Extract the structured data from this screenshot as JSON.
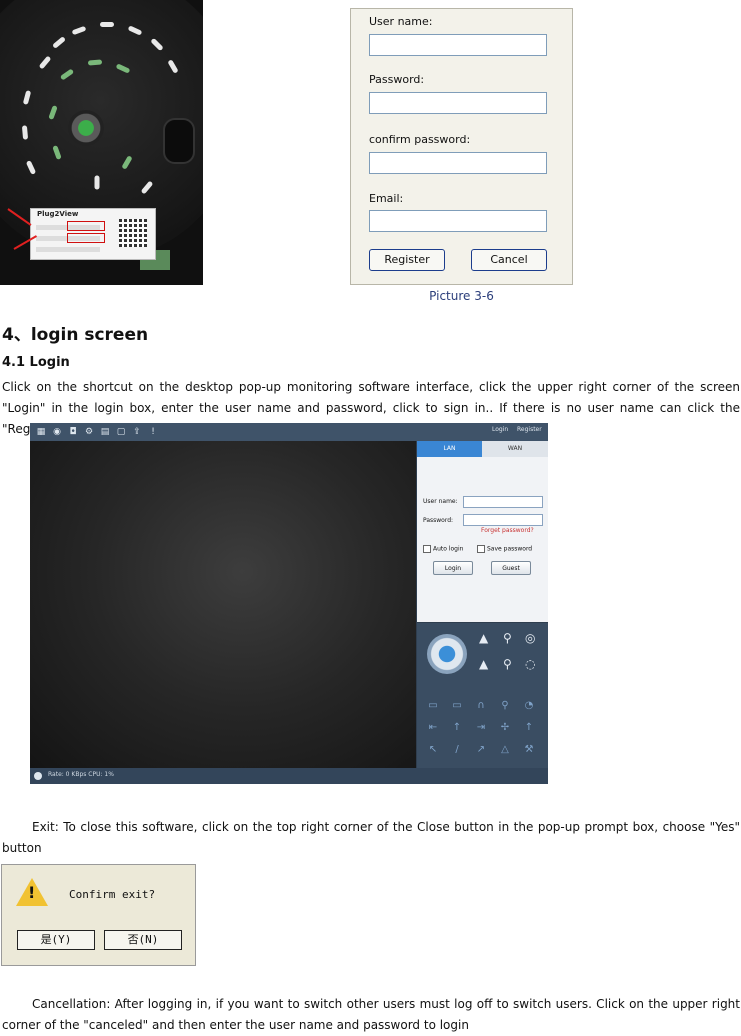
{
  "photo": {
    "brand_label": "Plug2View"
  },
  "register_dialog": {
    "username_label": "User name:",
    "password_label": "Password:",
    "confirm_label": "confirm password:",
    "email_label": "Email:",
    "register_button": "Register",
    "cancel_button": "Cancel"
  },
  "caption_1": "Picture 3-6",
  "section_heading": "4、login screen",
  "subsection_heading": "4.1 Login",
  "paragraph_1": "Click on the shortcut on the desktop pop-up monitoring software interface, click the upper right corner of the screen \"Login\" in the login box, enter the user name and password, click to sign in.. If there is no user name can click the \"Register\" and follow the prompts to apply.",
  "app": {
    "toolbar_login": "Login",
    "toolbar_register": "Register",
    "tab_left": "LAN",
    "tab_right": "WAN",
    "username_label": "User name:",
    "password_label": "Password:",
    "forgot_password": "Forget password?",
    "auto_login": "Auto login",
    "save_password": "Save password",
    "login_button": "Login",
    "guest_button": "Guest",
    "status_text": "Rate: 0 KBps  CPU: 1%"
  },
  "paragraph_2": "Exit: To close this software, click on the top right corner of the Close button in the pop-up prompt box, choose \"Yes\" button",
  "confirm_dialog": {
    "message": "Confirm exit?",
    "yes_button": "是(Y)",
    "no_button": "否(N)"
  },
  "paragraph_3": "Cancellation: After logging in, if you want to switch other users must log off to switch users. Click on the upper right corner of the \"canceled\" and then enter the user name and password to login"
}
